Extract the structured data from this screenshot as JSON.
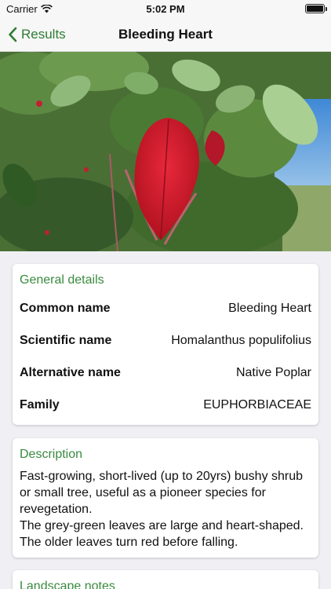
{
  "status_bar": {
    "carrier": "Carrier",
    "time": "5:02 PM"
  },
  "nav": {
    "back_label": "Results",
    "title": "Bleeding Heart"
  },
  "hero": {
    "icon": "plant-photo"
  },
  "general_details": {
    "title": "General details",
    "rows": [
      {
        "label": "Common name",
        "value": "Bleeding Heart"
      },
      {
        "label": "Scientific name",
        "value": "Homalanthus populifolius"
      },
      {
        "label": "Alternative name",
        "value": "Native Poplar"
      },
      {
        "label": "Family",
        "value": "EUPHORBIACEAE"
      }
    ]
  },
  "description": {
    "title": "Description",
    "text": "Fast-growing, short-lived (up to 20yrs)  bushy shrub or small tree, useful as a pioneer species for revegetation.\nThe grey-green leaves are large and heart-shaped. The older leaves turn red before falling."
  },
  "landscape_notes": {
    "title": "Landscape notes"
  },
  "colors": {
    "accent": "#3a8a3f",
    "background": "#efeff4",
    "card": "#ffffff"
  }
}
